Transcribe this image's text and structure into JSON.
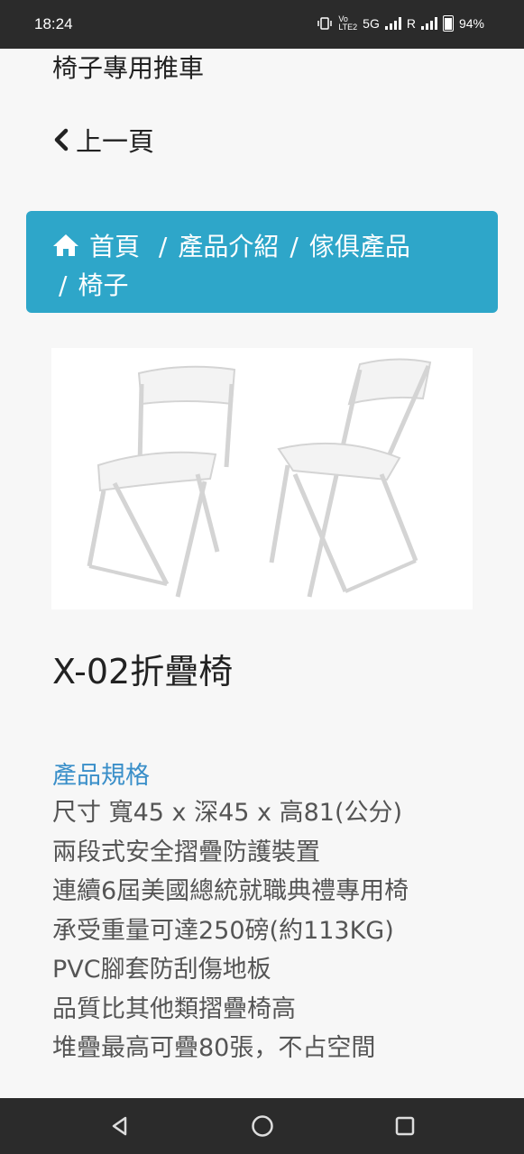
{
  "status_bar": {
    "time": "18:24",
    "network": "5G",
    "roaming": "R",
    "battery": "94%",
    "icons": [
      "vibrate-icon",
      "volte-icon",
      "signal-icon",
      "battery-icon"
    ]
  },
  "page": {
    "top_title": "椅子專用推車",
    "back_label": "上一頁"
  },
  "breadcrumb": {
    "items": [
      "首頁",
      "產品介紹",
      "傢俱產品",
      "椅子"
    ],
    "separator": "/",
    "color": "#2ea6c9"
  },
  "product": {
    "image_alt": "white folding chairs",
    "name": "X-02折疊椅",
    "spec_heading": "產品規格",
    "spec_heading_color": "#3a8fc9",
    "specs": [
      "尺寸 寬45 x 深45 x 高81(公分)",
      "兩段式安全摺疊防護裝置",
      "連續6屆美國總統就職典禮專用椅",
      "承受重量可達250磅(約113KG)",
      "PVC腳套防刮傷地板",
      "品質比其他類摺疊椅高",
      "堆疊最高可疊80張，不占空間"
    ]
  },
  "nav_bar": {
    "buttons": [
      "back-icon",
      "home-icon",
      "recents-icon"
    ]
  }
}
